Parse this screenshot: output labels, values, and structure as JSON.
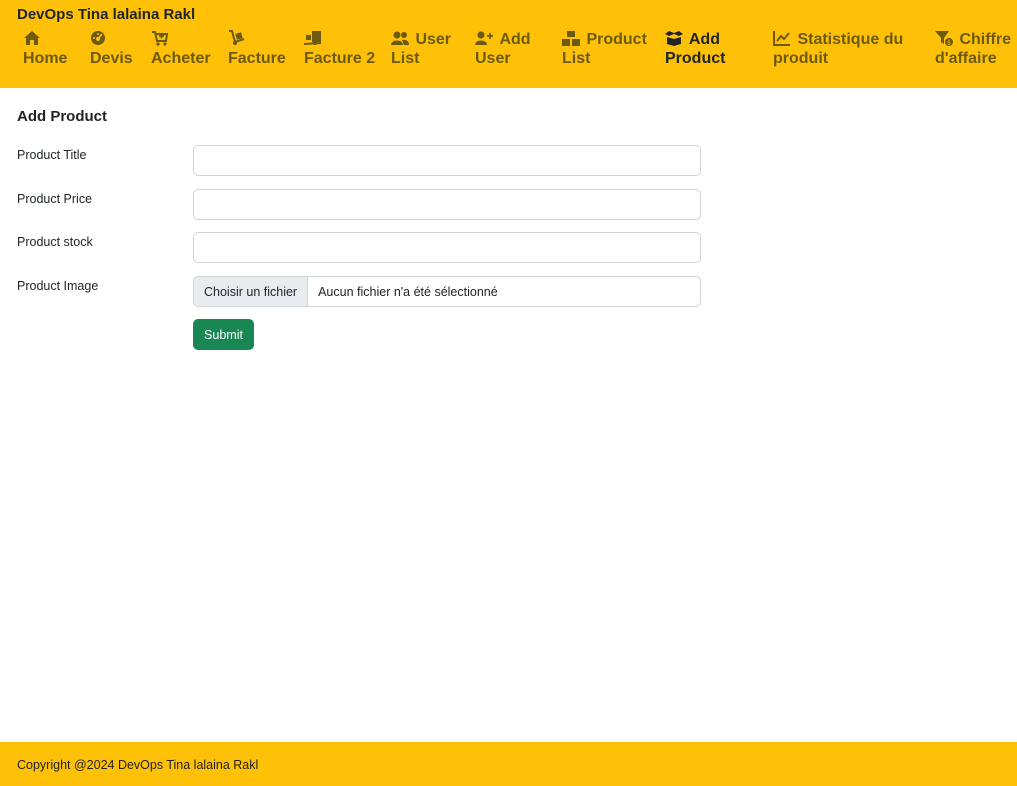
{
  "brand": "DevOps Tina lalaina Rakl",
  "nav": [
    {
      "icon": "home-icon",
      "line1": "Home",
      "line2": ""
    },
    {
      "icon": "gauge-icon",
      "line1": "Devis",
      "line2": ""
    },
    {
      "icon": "cart-plus-icon",
      "line1": "Acheter",
      "line2": ""
    },
    {
      "icon": "dolly-icon",
      "line1": "Facture",
      "line2": ""
    },
    {
      "icon": "truck-ramp-icon",
      "line1": "Facture 2",
      "line2": ""
    },
    {
      "icon": "users-icon",
      "line1": "User",
      "line2": "List"
    },
    {
      "icon": "user-plus-icon",
      "line1": "Add",
      "line2": "User"
    },
    {
      "icon": "boxes-icon",
      "line1": "Product",
      "line2": "List"
    },
    {
      "icon": "box-open-icon",
      "line1": "Add",
      "line2": "Product"
    },
    {
      "icon": "chart-line-icon",
      "line1": "Statistique du",
      "line2": "produit"
    },
    {
      "icon": "filter-dollar-icon",
      "line1": "Chiffre",
      "line2": "d'affaire"
    }
  ],
  "page_title": "Add Product",
  "form": {
    "title_label": "Product Title",
    "title_value": "",
    "price_label": "Product Price",
    "price_value": "",
    "stock_label": "Product stock",
    "stock_value": "",
    "image_label": "Product Image",
    "file_button": "Choisir un fichier",
    "file_status": "Aucun fichier n'a été sélectionné",
    "submit_label": "Submit"
  },
  "footer": "Copyright @2024 DevOps Tina lalaina Rakl",
  "colors": {
    "header": "#ffc107",
    "submit": "#198754"
  }
}
